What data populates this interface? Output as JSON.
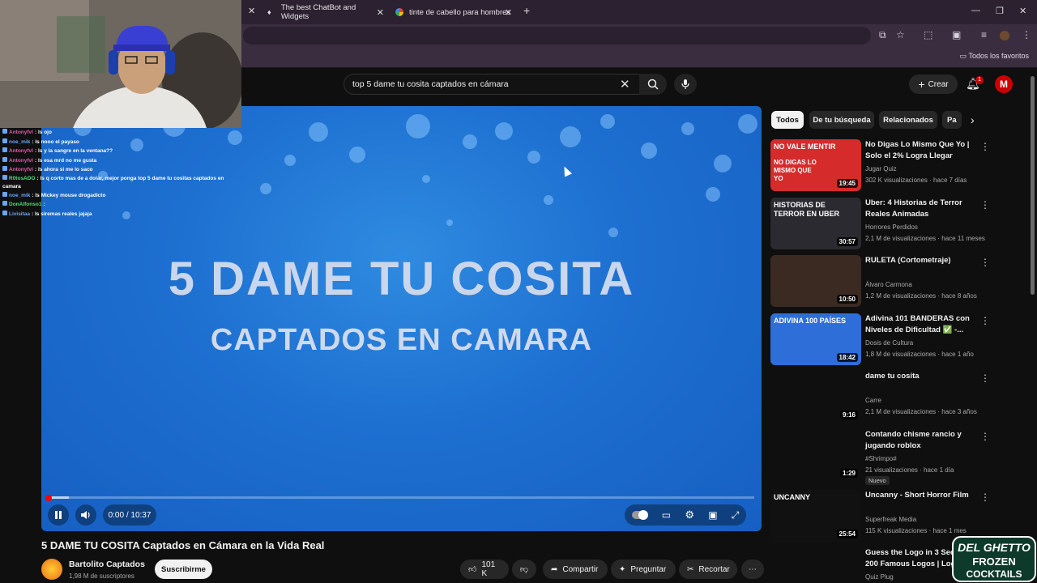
{
  "browser": {
    "tabs": [
      {
        "title": "The best ChatBot and Widgets"
      },
      {
        "title": "tinte de cabello para hombres"
      }
    ],
    "bookmarks_folder": "Todos los favoritos"
  },
  "youtube": {
    "search_query": "top 5 dame tu cosita captados en cámara",
    "create_label": "Crear",
    "notification_count": "1",
    "avatar_letter": "M"
  },
  "chat": [
    {
      "user": "Antonyfvl",
      "message": "ls ojo",
      "color": "#e05aa8"
    },
    {
      "user": "noe_mik",
      "message": "ls nooo el payaso",
      "color": "#6aa6ff"
    },
    {
      "user": "Antonyfvl",
      "message": "ls y la sangre en la ventana??",
      "color": "#e05aa8"
    },
    {
      "user": "Antonyfvl",
      "message": "ls esa mrd no me gusta",
      "color": "#e05aa8"
    },
    {
      "user": "Antonyfvl",
      "message": "ls ahora si me lo saco",
      "color": "#e05aa8"
    },
    {
      "user": "R0tosADO",
      "message": "ls q corto mas de a dolar, mejor ponga top 5 dame tu cositas captados en camara",
      "color": "#4de07a"
    },
    {
      "user": "noe_mik",
      "message": "ls Mickey mouse drogadicto",
      "color": "#6aa6ff"
    },
    {
      "user": "DonAlfonso1",
      "message": "",
      "color": "#4de07a"
    },
    {
      "user": "Livisitaa",
      "message": "ls siremas reales jajaja",
      "color": "#6aa6ff"
    }
  ],
  "player": {
    "overlay_line1": "5 DAME TU COSITA",
    "overlay_line2": "CAPTADOS EN CAMARA",
    "time": "0:00 / 10:37",
    "progress_fraction": 0
  },
  "video": {
    "title": "5 DAME TU COSITA Captados en Cámara en la Vida Real",
    "channel": "Bartolito Captados",
    "subscribers": "1,98 M de suscriptores",
    "subscribe_label": "Suscribirme",
    "likes": "101 K",
    "share_label": "Compartir",
    "ask_label": "Preguntar",
    "clip_label": "Recortar"
  },
  "chips": [
    "Todos",
    "De tu búsqueda",
    "Relacionados",
    "Pa"
  ],
  "recommendations": [
    {
      "title": "No Digas Lo Mismo Que Yo | Solo el 2% Logra Llegar",
      "channel": "Jugar Quiz",
      "meta": "302 K visualizaciones · hace 7 días",
      "duration": "19:45",
      "thumb_text": "NO VALE MENTIR",
      "thumb_sub": "NO DIGAS LO MISMO QUE YO",
      "thumb_color": "#d62b2b"
    },
    {
      "title": "Uber: 4 Historias de Terror Reales Animadas",
      "channel": "Horrores Perdidos",
      "meta": "2,1 M de visualizaciones · hace 11 meses",
      "duration": "30:57",
      "thumb_text": "HISTORIAS DE TERROR EN UBER",
      "thumb_sub": "",
      "thumb_color": "#2a2a30"
    },
    {
      "title": "RULETA (Cortometraje)",
      "channel": "Álvaro Carmona",
      "meta": "1,2 M de visualizaciones · hace 8 años",
      "duration": "10:50",
      "thumb_text": "",
      "thumb_sub": "",
      "thumb_color": "#3a2a22"
    },
    {
      "title": "Adivina 101 BANDERAS con Niveles de Dificultad ✅ -...",
      "channel": "Dosis de Cultura",
      "meta": "1,8 M de visualizaciones · hace 1 año",
      "duration": "18:42",
      "thumb_text": "ADIVINA 100 PAÍSES",
      "thumb_sub": "",
      "thumb_color": "#2d6ed8"
    },
    {
      "title": "dame tu cosita",
      "channel": "Carre",
      "meta": "2,1 M de visualizaciones · hace 3 años",
      "duration": "9:16",
      "thumb_text": "",
      "thumb_sub": "",
      "thumb_color": "#0f0f0f"
    },
    {
      "title": "Contando chisme rancio y jugando roblox",
      "channel": "#Shrimpo#",
      "meta": "21 visualizaciones · hace 1 día",
      "duration": "1:29",
      "badge": "Nuevo",
      "thumb_text": "",
      "thumb_sub": "",
      "thumb_color": "#0f0f0f"
    },
    {
      "title": "Uncanny - Short Horror Film",
      "channel": "Superfreak Media",
      "meta": "115 K visualizaciones · hace 1 mes",
      "duration": "25:54",
      "thumb_text": "UNCANNY",
      "thumb_sub": "",
      "thumb_color": "#111"
    },
    {
      "title": "Guess the Logo in 3 Seco... 200 Famous Logos | Logo...",
      "channel": "Quiz Plug",
      "meta": "",
      "duration": "",
      "thumb_text": "",
      "thumb_sub": "",
      "thumb_color": "#0f0f0f"
    }
  ],
  "watermark": {
    "line1": "DEL GHETTO",
    "line2": "FROZEN",
    "line3": "COCKTAILS"
  },
  "colors": {
    "accent_red": "#ff0000",
    "bg": "#0f0f0f",
    "player_blue": "#1d6fd0"
  }
}
